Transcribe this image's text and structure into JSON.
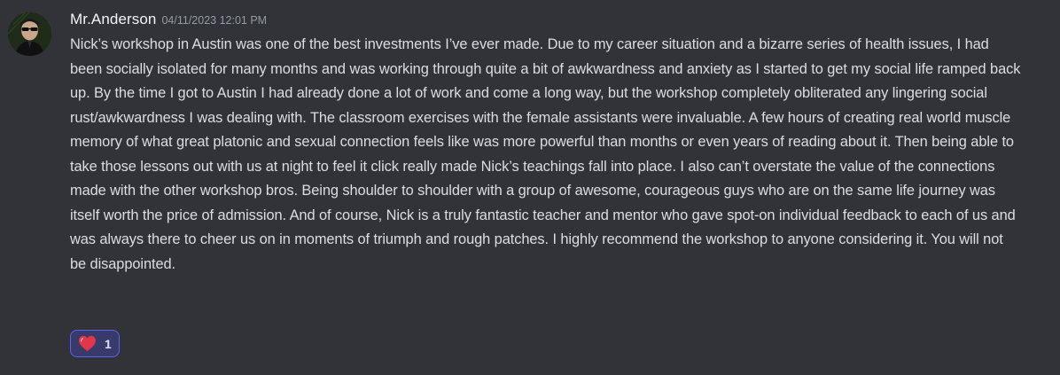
{
  "message": {
    "username": "Mr.Anderson",
    "timestamp": "04/11/2023 12:01 PM",
    "avatar_icon": "user-avatar-icon",
    "content": "Nick’s workshop in Austin was one of the best investments I’ve ever made. Due to my career situation and a bizarre series of health issues, I had been socially isolated for many months and was working through quite a bit of awkwardness and anxiety as I started to get my social life ramped back up. By the time I got to Austin I had already done a lot of work and come a long way, but the workshop completely obliterated any lingering social rust/awkwardness I was dealing with. The classroom exercises with the female assistants were invaluable. A few hours of creating real world muscle memory of what great platonic and sexual connection feels like was more powerful than months or even years of reading about it. Then being able to take those lessons out with us at night to feel it click really made Nick’s teachings fall into place. I also can’t overstate the value of the connections made with the other workshop bros. Being shoulder to shoulder with a group of awesome, courageous guys who are on the same life journey was itself worth the price of admission. And of course, Nick is a truly fantastic teacher and mentor who gave spot-on individual feedback to each of us and was always there to cheer us on in moments of triumph and rough patches. I highly recommend the workshop to anyone considering it. You will not be disappointed.",
    "reactions": [
      {
        "emoji": "heart-icon",
        "count": "1"
      }
    ]
  },
  "colors": {
    "background": "#313338",
    "username": "#f2f3f5",
    "timestamp": "#949ba4",
    "text": "#dbdee1",
    "reaction_bg": "#373a6a",
    "reaction_border": "#5865f2",
    "heart": "#e0384a"
  }
}
